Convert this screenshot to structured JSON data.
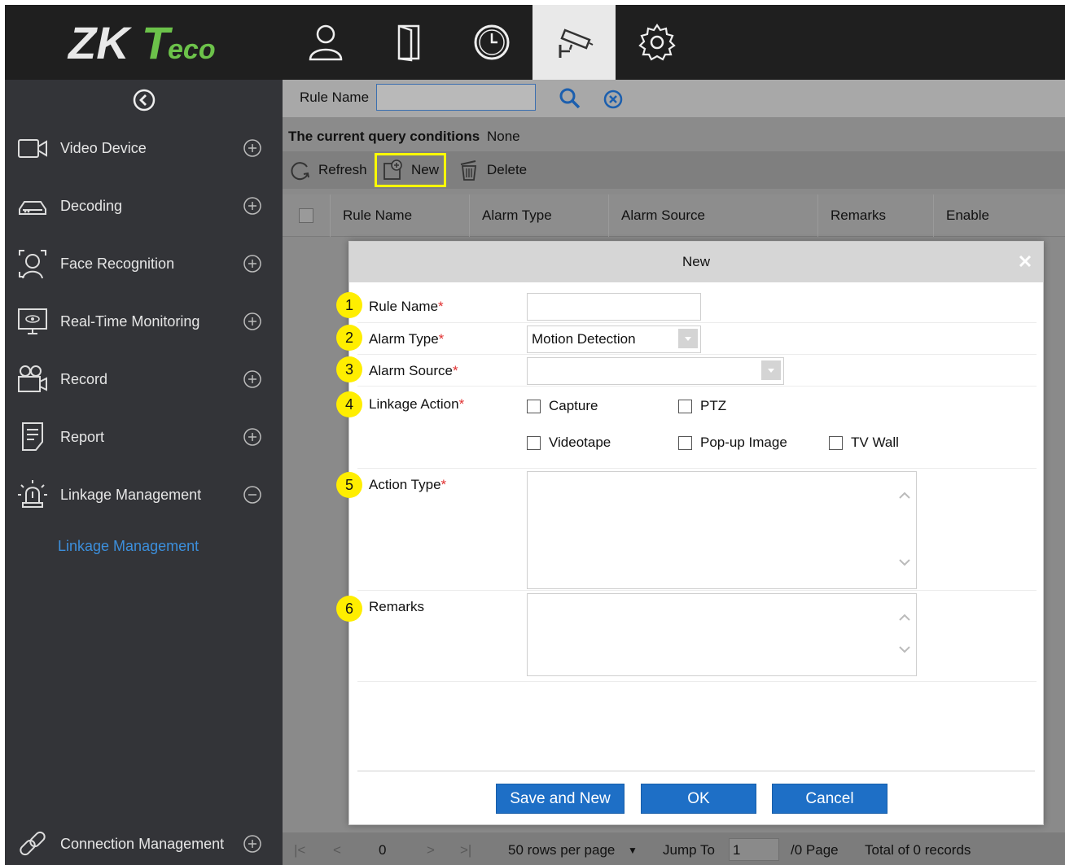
{
  "app": {
    "brand": "ZKTeco",
    "brand_color": "#6cc24a",
    "accent_color": "#1e6fc6",
    "highlight_color": "#ffff00"
  },
  "top_nav": [
    {
      "icon": "person-icon"
    },
    {
      "icon": "door-icon"
    },
    {
      "icon": "clock-icon"
    },
    {
      "icon": "cctv-camera-icon",
      "active": true
    },
    {
      "icon": "settings-gear-icon"
    }
  ],
  "sidebar": {
    "items": [
      {
        "label": "Video Device",
        "icon": "video-camera-icon"
      },
      {
        "label": "Decoding",
        "icon": "decoder-icon"
      },
      {
        "label": "Face Recognition",
        "icon": "face-scan-icon"
      },
      {
        "label": "Real-Time Monitoring",
        "icon": "monitor-eye-icon"
      },
      {
        "label": "Record",
        "icon": "record-camera-icon"
      },
      {
        "label": "Report",
        "icon": "report-document-icon"
      },
      {
        "label": "Linkage Management",
        "icon": "alarm-beacon-icon",
        "expanded": true
      }
    ],
    "sub_item": "Linkage Management",
    "bottom_item": {
      "label": "Connection Management",
      "icon": "link-chain-icon"
    }
  },
  "query": {
    "label": "Rule Name",
    "value": "",
    "conditions_label": "The current query conditions",
    "conditions_value": "None"
  },
  "toolbar": {
    "refresh": "Refresh",
    "new": "New",
    "delete": "Delete"
  },
  "grid": {
    "columns": [
      "Rule Name",
      "Alarm Type",
      "Alarm Source",
      "Remarks",
      "Enable"
    ]
  },
  "pager": {
    "current": "0",
    "rows_per_page": "50 rows per page",
    "jump_to_label": "Jump To",
    "jump_to_value": "1",
    "page_suffix": "/0 Page",
    "total": "Total of 0 records"
  },
  "modal": {
    "title": "New",
    "fields": {
      "rule_name": {
        "badge": "1",
        "label": "Rule Name",
        "req": "*",
        "value": ""
      },
      "alarm_type": {
        "badge": "2",
        "label": "Alarm Type",
        "req": "*",
        "value": "Motion Detection"
      },
      "alarm_source": {
        "badge": "3",
        "label": "Alarm Source",
        "req": "*",
        "value": ""
      },
      "linkage_action": {
        "badge": "4",
        "label": "Linkage Action",
        "req": "*",
        "options": [
          {
            "label": "Capture",
            "checked": false
          },
          {
            "label": "PTZ",
            "checked": false
          },
          {
            "label": "Videotape",
            "checked": false
          },
          {
            "label": "Pop-up Image",
            "checked": false
          },
          {
            "label": "TV Wall",
            "checked": false
          }
        ]
      },
      "action_type": {
        "badge": "5",
        "label": "Action Type",
        "req": "*",
        "value": ""
      },
      "remarks": {
        "badge": "6",
        "label": "Remarks",
        "value": ""
      }
    },
    "buttons": {
      "save_and_new": "Save and New",
      "ok": "OK",
      "cancel": "Cancel"
    }
  }
}
